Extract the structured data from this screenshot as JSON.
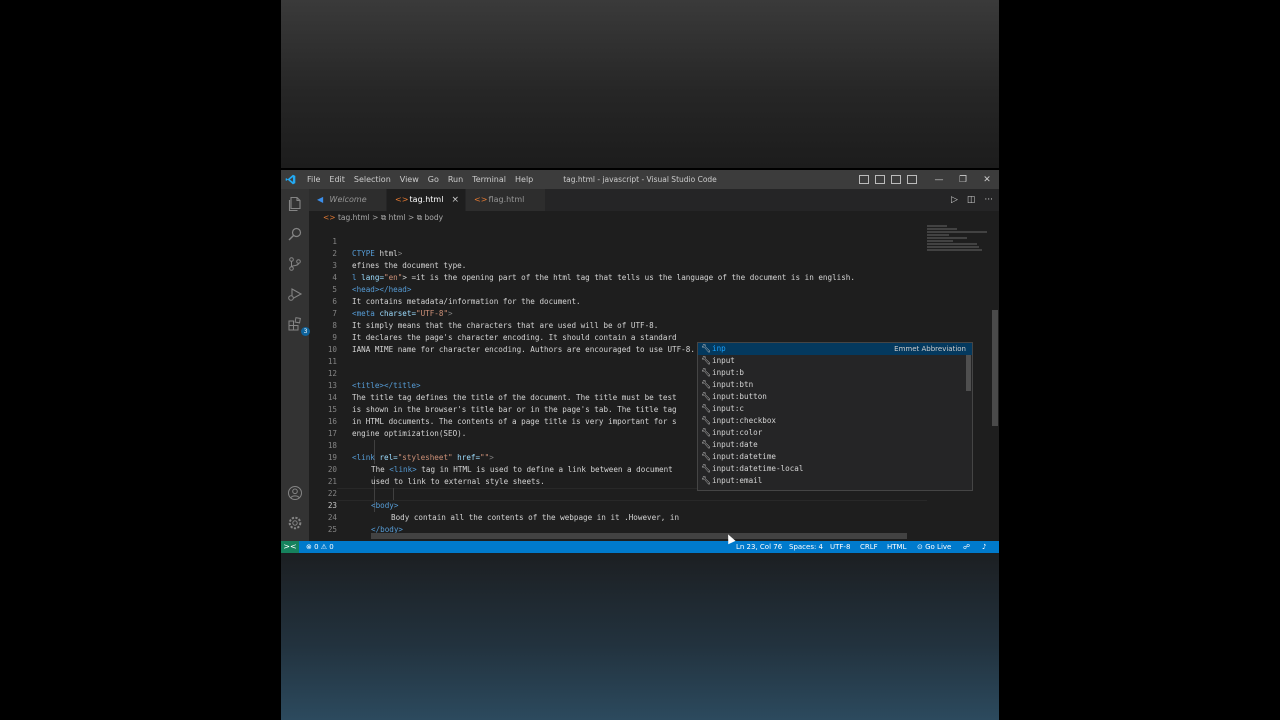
{
  "titlebar": {
    "menu": [
      "File",
      "Edit",
      "Selection",
      "View",
      "Go",
      "Run",
      "Terminal",
      "Help"
    ],
    "title": "tag.html - javascript - Visual Studio Code",
    "window_controls": [
      "—",
      "❐",
      "✕"
    ]
  },
  "tabs": [
    {
      "label": "Welcome",
      "icon": "vscode-icon"
    },
    {
      "label": "tag.html",
      "icon": "html-icon",
      "close": "×"
    },
    {
      "label": "flag.html",
      "icon": "html-icon"
    }
  ],
  "breadcrumb": {
    "file": "tag.html",
    "sep": ">",
    "item1": "html",
    "item2": "body"
  },
  "editor_actions": [
    "▷",
    "◫",
    "···"
  ],
  "code": {
    "l1": {
      "n": "1",
      "a": "CTYPE ",
      "b": "html",
      "c": ">"
    },
    "l2": {
      "n": "2",
      "t": "efines the document type."
    },
    "l3": {
      "n": "3",
      "a": "l ",
      "b": "lang=",
      "c": "\"en\"",
      "d": "> =it is the opening part of the html tag that tells us the language of the document is in english."
    },
    "l4": {
      "n": "4",
      "t": "<head></head>"
    },
    "l5": {
      "n": "5",
      "t": "It contains metadata/information for the document."
    },
    "l6": {
      "n": "6",
      "a": "<meta ",
      "b": "charset=",
      "c": "\"UTF-8\"",
      "d": ">"
    },
    "l7": {
      "n": "7",
      "t": "It simply means that the characters that are used will be of UTF-8."
    },
    "l8": {
      "n": "8",
      "t": "It declares the page's character encoding. It should contain a standard"
    },
    "l9": {
      "n": "9",
      "t": "IANA MIME name for character encoding. Authors are encouraged to use UTF-8."
    },
    "l10": {
      "n": "10"
    },
    "l11": {
      "n": "11"
    },
    "l12": {
      "n": "12",
      "t": "<title></title>"
    },
    "l13": {
      "n": "13",
      "t": "The title tag defines the title of the document. The title must be test"
    },
    "l14": {
      "n": "14",
      "t": "is shown in the browser's title bar or in the page's tab. The title tag"
    },
    "l15": {
      "n": "15",
      "t": "in HTML documents. The contents of a page title is very important for s"
    },
    "l16": {
      "n": "16",
      "t": "engine optimization(SEO)."
    },
    "l17": {
      "n": "17"
    },
    "l18": {
      "n": "18",
      "a": "<link ",
      "b": "rel=",
      "c": "\"stylesheet\"",
      "d": " href=",
      "e": "\"\"",
      "f": ">"
    },
    "l19": {
      "n": "19",
      "a": "The ",
      "b": "<link>",
      "c": " tag in HTML is used to define a link between a document"
    },
    "l20": {
      "n": "20",
      "t": "used to link to external style sheets."
    },
    "l21": {
      "n": "21"
    },
    "l22": {
      "n": "22",
      "t": "<body>"
    },
    "l23": {
      "n": "23",
      "t": "Body contain all the contents of the webpage in it .However, in"
    },
    "l24": {
      "n": "24",
      "t": "</body>"
    },
    "l25": {
      "n": "25"
    }
  },
  "suggest": {
    "detail": "Emmet Abbreviation",
    "items": [
      "inp",
      "input",
      "input:b",
      "input:btn",
      "input:button",
      "input:c",
      "input:checkbox",
      "input:color",
      "input:date",
      "input:datetime",
      "input:datetime-local",
      "input:email"
    ]
  },
  "status": {
    "remote": "><",
    "errors": "⊗ 0",
    "warnings": "⚠ 0",
    "position": "Ln 23, Col 76",
    "spaces": "Spaces: 4",
    "encoding": "UTF-8",
    "eol": "CRLF",
    "language": "HTML",
    "golive": "Go Live",
    "feedback": "☍",
    "bell": "🔔"
  }
}
